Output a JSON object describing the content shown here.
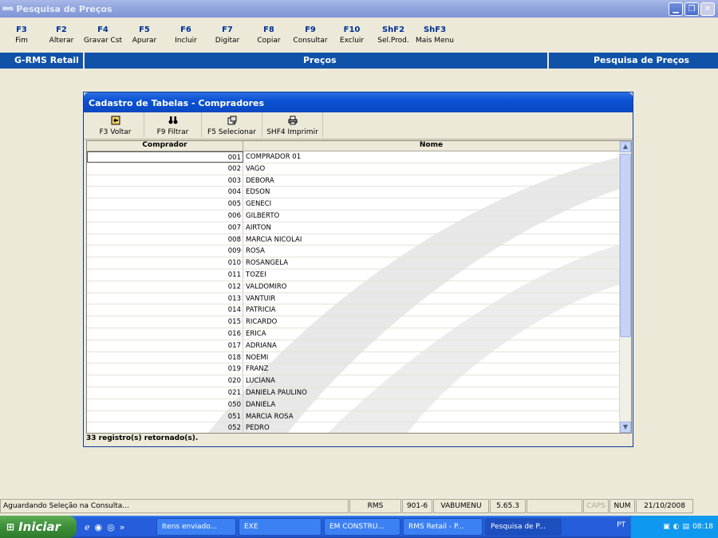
{
  "window": {
    "app_icon": "RMS",
    "title": "Pesquisa de Preços",
    "controls": [
      "minimize-icon",
      "maximize-icon",
      "close-icon"
    ]
  },
  "fkeys": [
    {
      "key": "F3",
      "label": "Fim"
    },
    {
      "key": "F2",
      "label": "Alterar"
    },
    {
      "key": "F4",
      "label": "Gravar Cst"
    },
    {
      "key": "F5",
      "label": "Apurar"
    },
    {
      "key": "F6",
      "label": "Incluir"
    },
    {
      "key": "F7",
      "label": "Digitar"
    },
    {
      "key": "F8",
      "label": "Copiar"
    },
    {
      "key": "F9",
      "label": "Consultar"
    },
    {
      "key": "F10",
      "label": "Excluir"
    },
    {
      "key": "ShF2",
      "label": "Sel.Prod."
    },
    {
      "key": "ShF3",
      "label": "Mais Menu"
    }
  ],
  "band": {
    "left": "G-RMS Retail",
    "center": "Preços",
    "right": "Pesquisa de Preços"
  },
  "dialog": {
    "title": "Cadastro de Tabelas - Compradores",
    "toolbar": [
      {
        "label": "F3 Voltar",
        "icon": "back-icon"
      },
      {
        "label": "F9 Filtrar",
        "icon": "binoculars-icon"
      },
      {
        "label": "F5 Selecionar",
        "icon": "select-icon"
      },
      {
        "label": "SHF4 Imprimir",
        "icon": "printer-icon"
      }
    ],
    "columns": [
      "Comprador",
      "Nome"
    ],
    "rows": [
      [
        "001",
        "COMPRADOR 01"
      ],
      [
        "002",
        "VAGO"
      ],
      [
        "003",
        "DEBORA"
      ],
      [
        "004",
        "EDSON"
      ],
      [
        "005",
        "GENECI"
      ],
      [
        "006",
        "GILBERTO"
      ],
      [
        "007",
        "AIRTON"
      ],
      [
        "008",
        "MARCIA NICOLAI"
      ],
      [
        "009",
        "ROSA"
      ],
      [
        "010",
        "ROSANGELA"
      ],
      [
        "011",
        "TOZEI"
      ],
      [
        "012",
        "VALDOMIRO"
      ],
      [
        "013",
        "VANTUIR"
      ],
      [
        "014",
        "PATRICIA"
      ],
      [
        "015",
        "RICARDO"
      ],
      [
        "016",
        "ERICA"
      ],
      [
        "017",
        "ADRIANA"
      ],
      [
        "018",
        "NOEMI"
      ],
      [
        "019",
        "FRANZ"
      ],
      [
        "020",
        "LUCIANA"
      ],
      [
        "021",
        "DANIELA PAULINO"
      ],
      [
        "050",
        "DANIELA"
      ],
      [
        "051",
        "MARCIA ROSA"
      ],
      [
        "052",
        "PEDRO"
      ]
    ],
    "status": "33 registro(s) retornado(s)."
  },
  "statusbar": {
    "message": "Aguardando Seleção na Consulta...",
    "system": "RMS",
    "code": "901-6",
    "menu": "VABUMENU",
    "version": "5.65.3",
    "caps": "CAPS",
    "num": "NUM",
    "date": "21/10/2008"
  },
  "taskbar": {
    "start": "Iniciar",
    "tasks": [
      "Itens enviado...",
      "EXE",
      "EM CONSTRU...",
      "RMS Retail - P...",
      "Pesquisa de P..."
    ],
    "lang": "PT",
    "time": "08:18"
  },
  "colors": {
    "band_blue": "#1052a8",
    "title_blue": "#0b52d4",
    "fkey_blue": "#003399"
  }
}
